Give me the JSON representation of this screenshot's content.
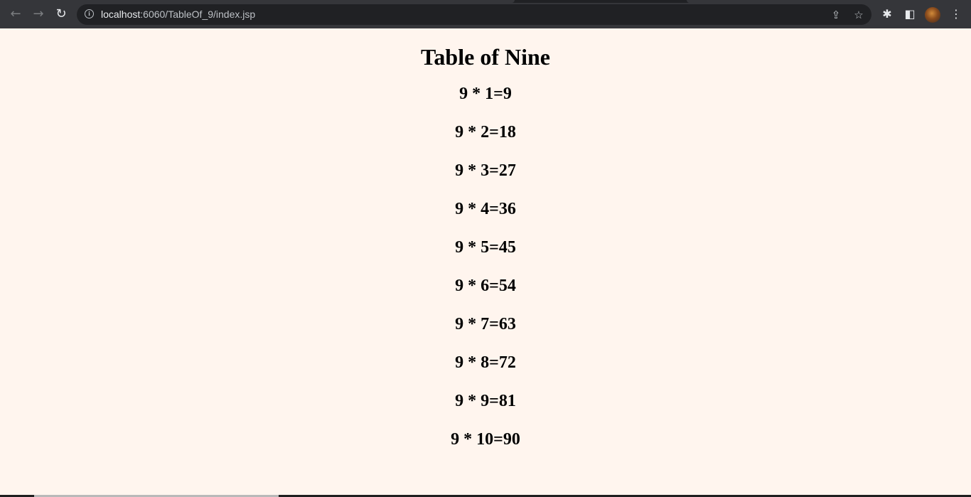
{
  "browser": {
    "back_icon": "←",
    "forward_icon": "→",
    "reload_icon": "↻",
    "info_icon": "i",
    "url_host": "localhost",
    "url_rest": ":6060/TableOf_9/index.jsp",
    "share_icon": "⇪",
    "star_icon": "☆",
    "extensions_icon": "✱",
    "side_panel_icon": "◧",
    "menu_icon": "⋮"
  },
  "page": {
    "title": "Table of Nine",
    "rows": [
      "9 * 1=9",
      "9 * 2=18",
      "9 * 3=27",
      "9 * 4=36",
      "9 * 5=45",
      "9 * 6=54",
      "9 * 7=63",
      "9 * 8=72",
      "9 * 9=81",
      "9 * 10=90"
    ]
  },
  "colors": {
    "toolbar": "#35363a",
    "omnibox": "#202124",
    "page_background": "#fff5ee",
    "text": "#000000"
  }
}
